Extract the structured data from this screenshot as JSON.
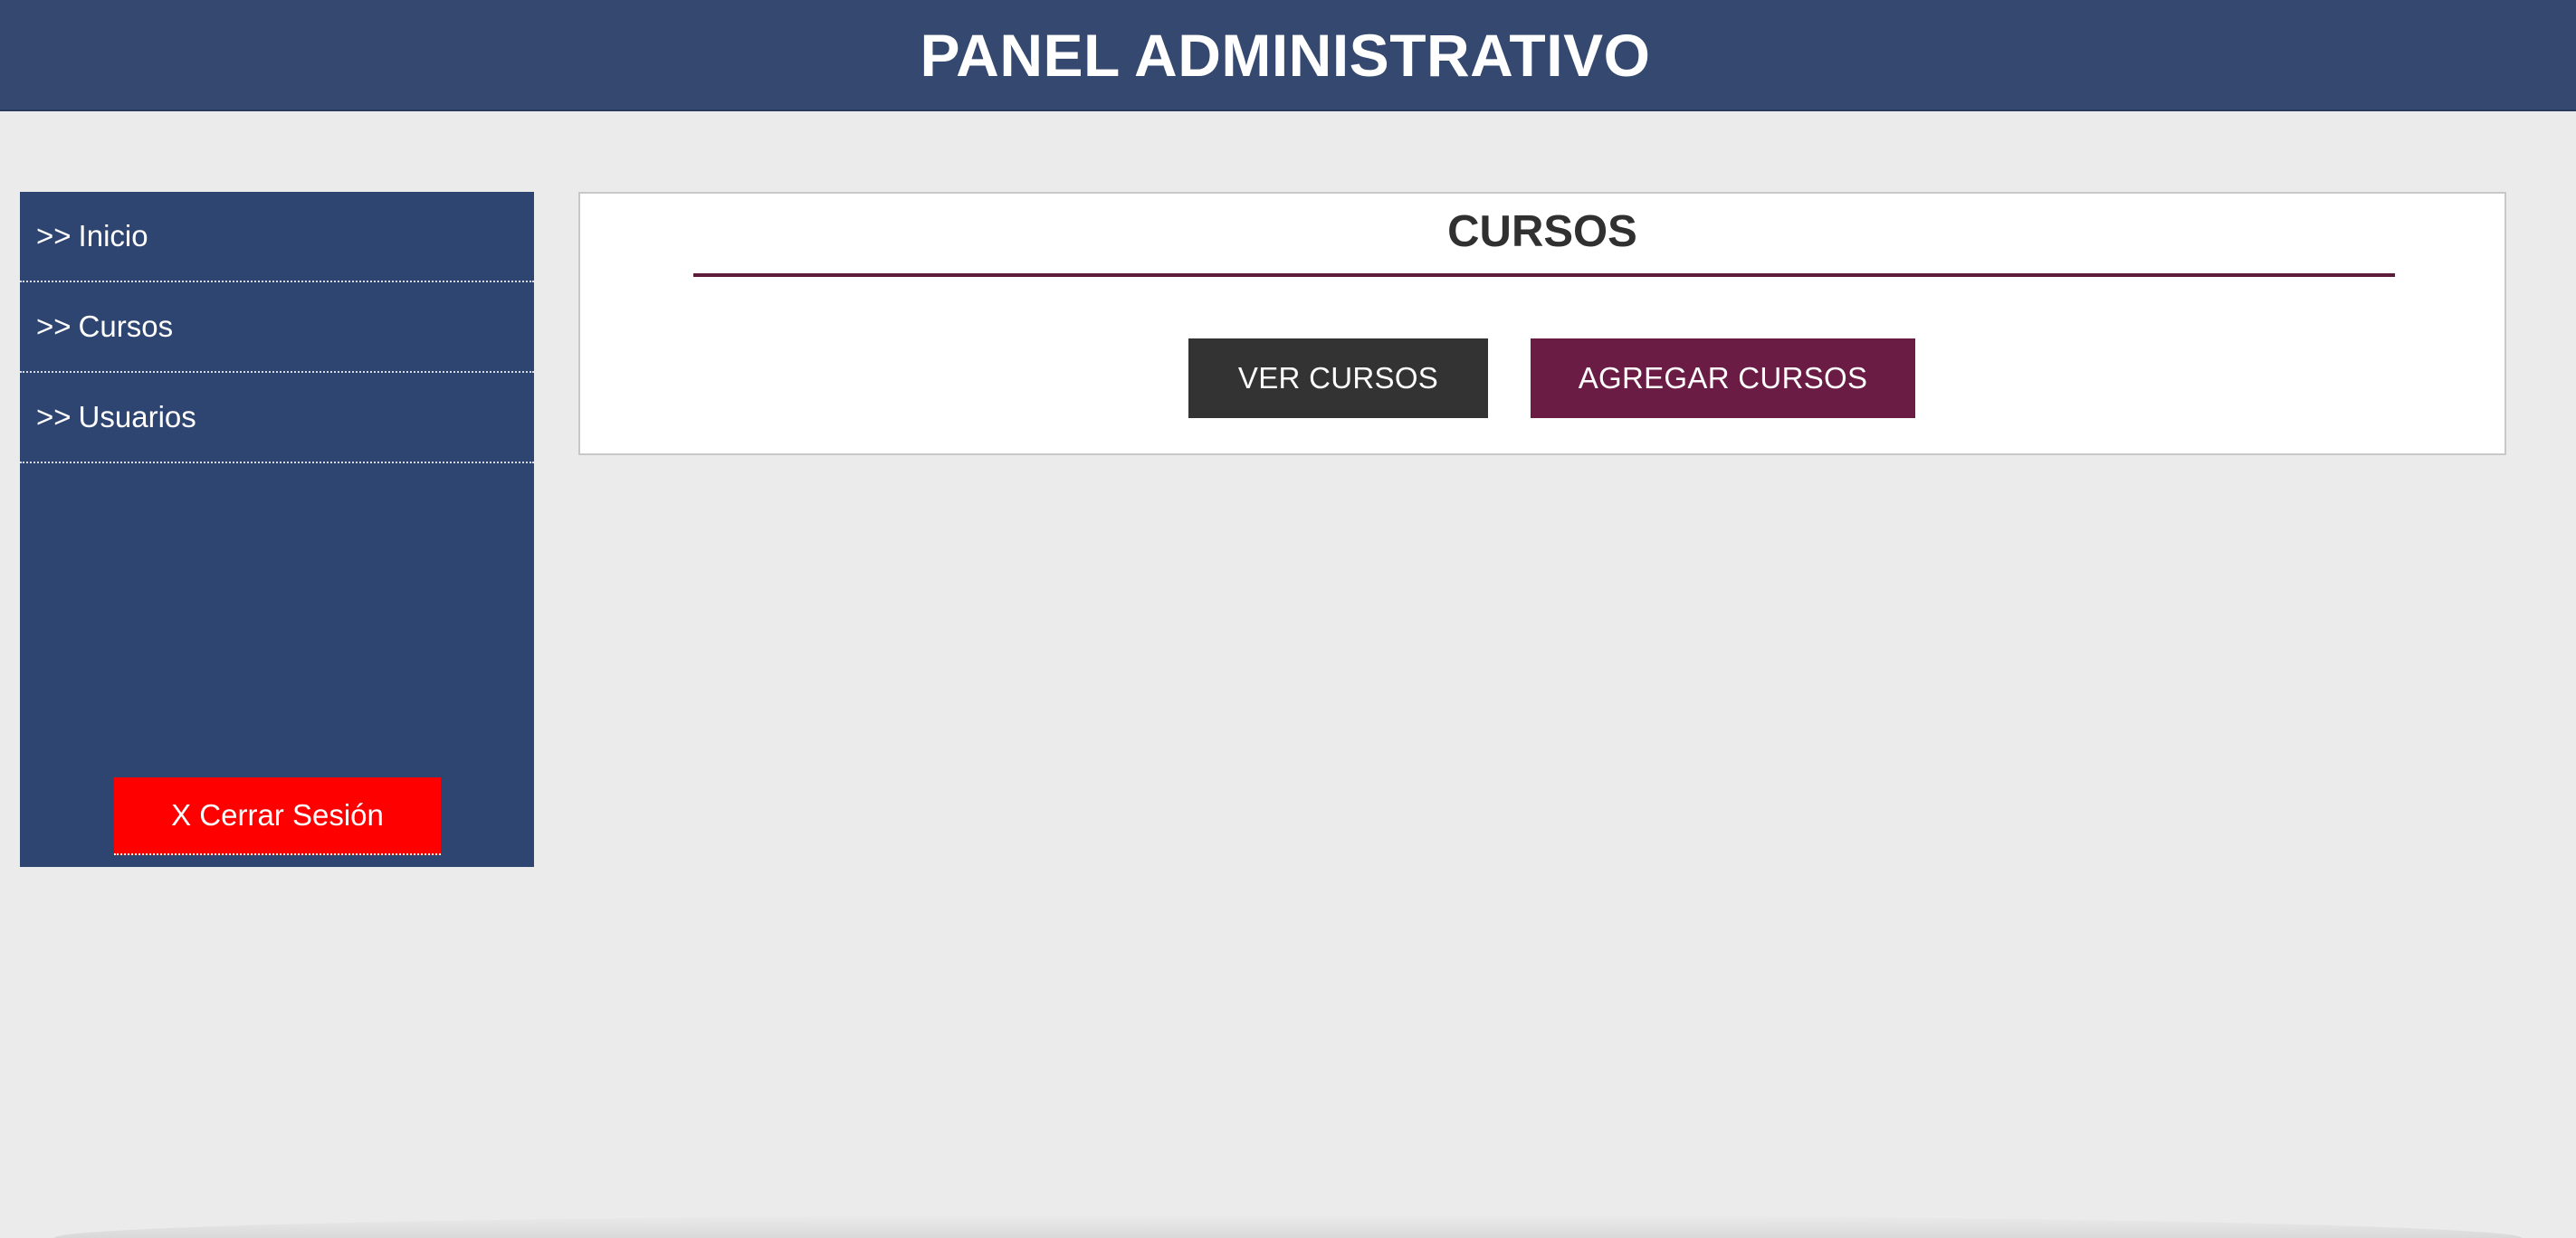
{
  "header": {
    "title": "PANEL ADMINISTRATIVO"
  },
  "sidebar": {
    "items": [
      {
        "prefix": ">>",
        "label": "Inicio"
      },
      {
        "prefix": ">>",
        "label": "Cursos"
      },
      {
        "prefix": ">>",
        "label": "Usuarios"
      }
    ],
    "logout_label": "X Cerrar Sesión"
  },
  "main": {
    "section_title": "CURSOS",
    "buttons": {
      "view_label": "VER CURSOS",
      "add_label": "AGREGAR CURSOS"
    }
  },
  "colors": {
    "header_bg": "#344870",
    "sidebar_bg": "#2e4571",
    "logout_bg": "#ff0000",
    "view_button_bg": "#333333",
    "add_button_bg": "#6b1c44",
    "accent_rule": "#5e1a3a",
    "page_bg": "#ebebeb"
  }
}
